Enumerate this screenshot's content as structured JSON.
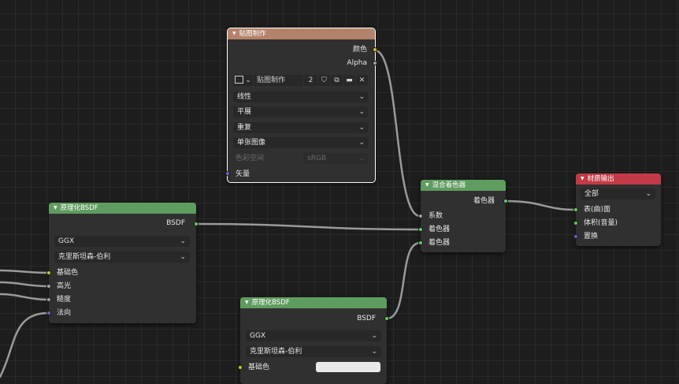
{
  "image_texture": {
    "title": "贴图制作",
    "out_color": "颜色",
    "out_alpha": "Alpha",
    "image_name": "贴图制作",
    "user_count": "2",
    "interpolation": "线性",
    "projection": "平展",
    "extension": "重复",
    "source": "单张图像",
    "color_space_label": "色彩空间",
    "color_space_value": "sRGB",
    "in_vector": "矢量"
  },
  "mix_shader": {
    "title": "混合着色器",
    "out_shader": "着色器",
    "in_fac": "系数",
    "in_shader1": "着色器",
    "in_shader2": "着色器"
  },
  "material_output": {
    "title": "材质输出",
    "target": "全部",
    "in_surface": "表(曲)面",
    "in_volume": "体积(音量)",
    "in_displacement": "置换"
  },
  "bsdf_left": {
    "title": "原理化BSDF",
    "out_bsdf": "BSDF",
    "distribution": "GGX",
    "subsurface": "克里斯坦森-伯利",
    "in_base_color": "基础色",
    "in_specular": "高光",
    "in_roughness": "糙度",
    "in_normal": "法向"
  },
  "bsdf_bottom": {
    "title": "原理化BSDF",
    "out_bsdf": "BSDF",
    "distribution": "GGX",
    "subsurface": "克里斯坦森-伯利",
    "in_base_color": "基础色"
  },
  "colors": {
    "texture_header": "#b4826a",
    "shader_header": "#5f9c5f",
    "output_header": "#c23a47",
    "socket_color": "#c7c729",
    "socket_float": "#a1a1a1",
    "socket_shader": "#63c763",
    "socket_vector": "#6363c7"
  }
}
